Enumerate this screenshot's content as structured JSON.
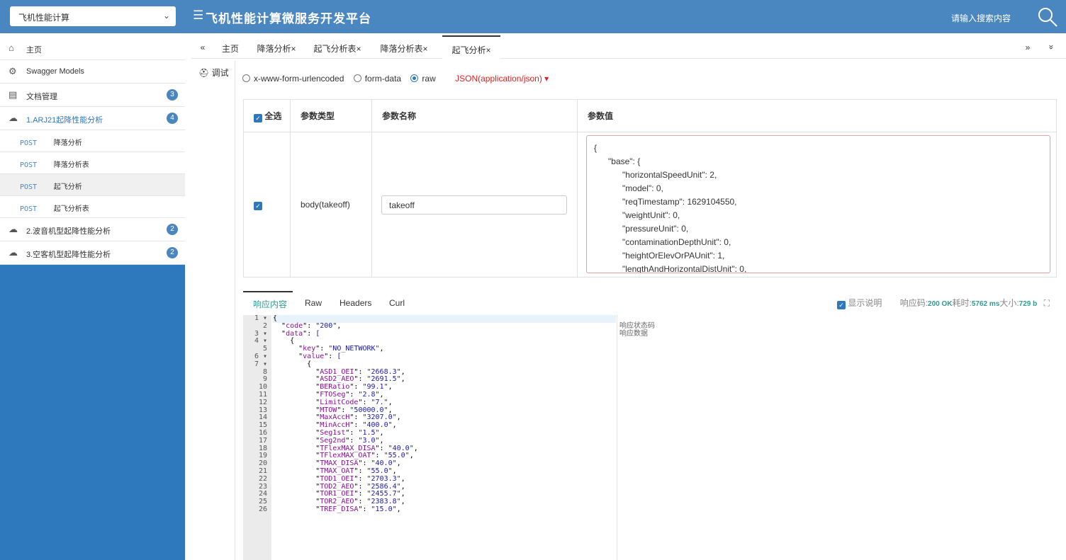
{
  "header": {
    "project_select": "飞机性能计算",
    "title": "飞机性能计算微服务开发平台",
    "menu_icon": "menu-icon",
    "search_placeholder": "请输入搜索内容",
    "search_icon": "search-icon"
  },
  "sidebar": {
    "items": [
      {
        "label": "主页",
        "icon": "home-icon"
      },
      {
        "label": "Swagger Models",
        "icon": "gear-icon"
      },
      {
        "label": "文档管理",
        "icon": "doc-icon",
        "badge": "3"
      },
      {
        "label": "1.ARJ21起降性能分析",
        "icon": "cloud-icon",
        "badge": "4"
      }
    ],
    "sub_items": [
      {
        "method": "POST",
        "label": "降落分析"
      },
      {
        "method": "POST",
        "label": "降落分析表"
      },
      {
        "method": "POST",
        "label": "起飞分析"
      },
      {
        "method": "POST",
        "label": "起飞分析表"
      }
    ],
    "more_items": [
      {
        "label": "2.波音机型起降性能分析",
        "icon": "cloud-icon",
        "badge": "2"
      },
      {
        "label": "3.空客机型起降性能分析",
        "icon": "cloud-icon",
        "badge": "2"
      }
    ]
  },
  "tabs": {
    "prev": "«",
    "items": [
      "主页",
      "降落分析×",
      "起飞分析表×",
      "降落分析表×",
      "起飞分析×"
    ],
    "next": "»",
    "more": "»"
  },
  "side_tab": "调试",
  "request": {
    "radio_urlencoded": "x-www-form-urlencoded",
    "radio_formdata": "form-data",
    "radio_raw": "raw",
    "content_type": "JSON(application/json) ▾",
    "table": {
      "headers": [
        "全选",
        "参数类型",
        "参数名称",
        "参数值"
      ],
      "row": {
        "type": "body(takeoff)",
        "name": "takeoff",
        "value": "{\n      \"base\": {\n            \"horizontalSpeedUnit\": 2,\n            \"model\": 0,\n            \"reqTimestamp\": 1629104550,\n            \"weightUnit\": 0,\n            \"pressureUnit\": 0,\n            \"contaminationDepthUnit\": 0,\n            \"heightOrElevOrPAUnit\": 1,\n            \"lengthAndHorizontalDistUnit\": 0,"
      }
    }
  },
  "response": {
    "tabs": [
      "响应内容",
      "Raw",
      "Headers",
      "Curl"
    ],
    "show_desc": "显示说明",
    "status_label": "响应码:",
    "status_value": "200 OK",
    "time_label": "耗时:",
    "time_value": "5762 ms",
    "size_label": "大小:",
    "size_value": "729 b",
    "line_numbers": [
      "1 ▾",
      "2",
      "3 ▾",
      "4 ▾",
      "5",
      "6 ▾",
      "7 ▾",
      "8",
      "9",
      "10",
      "11",
      "12",
      "13",
      "14",
      "15",
      "16",
      "17",
      "18",
      "19",
      "20",
      "21",
      "22",
      "23",
      "24",
      "25",
      "26"
    ],
    "descs": [
      "",
      "响应状态码",
      "响应数据"
    ],
    "code_lines": [
      {
        "text": "{"
      },
      {
        "key": "code",
        "val": "\"200\"",
        "indent": 1,
        "trail": ","
      },
      {
        "key": "data",
        "val": "[",
        "indent": 1
      },
      {
        "text": "{",
        "indent": 2
      },
      {
        "key": "key",
        "val": "\"NO_NETWORK\"",
        "indent": 3,
        "trail": ","
      },
      {
        "key": "value",
        "val": "[",
        "indent": 3
      },
      {
        "text": "{",
        "indent": 4
      },
      {
        "key": "ASD1_OEI",
        "val": "\"2668.3\"",
        "indent": 5,
        "trail": ","
      },
      {
        "key": "ASD2_AEO",
        "val": "\"2691.5\"",
        "indent": 5,
        "trail": ","
      },
      {
        "key": "BERatio",
        "val": "\"99.1\"",
        "indent": 5,
        "trail": ","
      },
      {
        "key": "FTOSeg",
        "val": "\"2.8\"",
        "indent": 5,
        "trail": ","
      },
      {
        "key": "LimitCode",
        "val": "\"7.\"",
        "indent": 5,
        "trail": ","
      },
      {
        "key": "MTOW",
        "val": "\"50000.0\"",
        "indent": 5,
        "trail": ","
      },
      {
        "key": "MaxAccH",
        "val": "\"3207.0\"",
        "indent": 5,
        "trail": ","
      },
      {
        "key": "MinAccH",
        "val": "\"400.0\"",
        "indent": 5,
        "trail": ","
      },
      {
        "key": "Seg1st",
        "val": "\"1.5\"",
        "indent": 5,
        "trail": ","
      },
      {
        "key": "Seg2nd",
        "val": "\"3.0\"",
        "indent": 5,
        "trail": ","
      },
      {
        "key": "TFlexMAX_DISA",
        "val": "\"40.0\"",
        "indent": 5,
        "trail": ","
      },
      {
        "key": "TFlexMAX_OAT",
        "val": "\"55.0\"",
        "indent": 5,
        "trail": ","
      },
      {
        "key": "TMAX_DISA",
        "val": "\"40.0\"",
        "indent": 5,
        "trail": ","
      },
      {
        "key": "TMAX_OAT",
        "val": "\"55.0\"",
        "indent": 5,
        "trail": ","
      },
      {
        "key": "TOD1_OEI",
        "val": "\"2703.3\"",
        "indent": 5,
        "trail": ","
      },
      {
        "key": "TOD2_AEO",
        "val": "\"2586.4\"",
        "indent": 5,
        "trail": ","
      },
      {
        "key": "TOR1_OEI",
        "val": "\"2455.7\"",
        "indent": 5,
        "trail": ","
      },
      {
        "key": "TOR2_AEO",
        "val": "\"2383.8\"",
        "indent": 5,
        "trail": ","
      },
      {
        "key": "TREF_DISA",
        "val": "\"15.0\"",
        "indent": 5,
        "trail": ","
      }
    ]
  }
}
